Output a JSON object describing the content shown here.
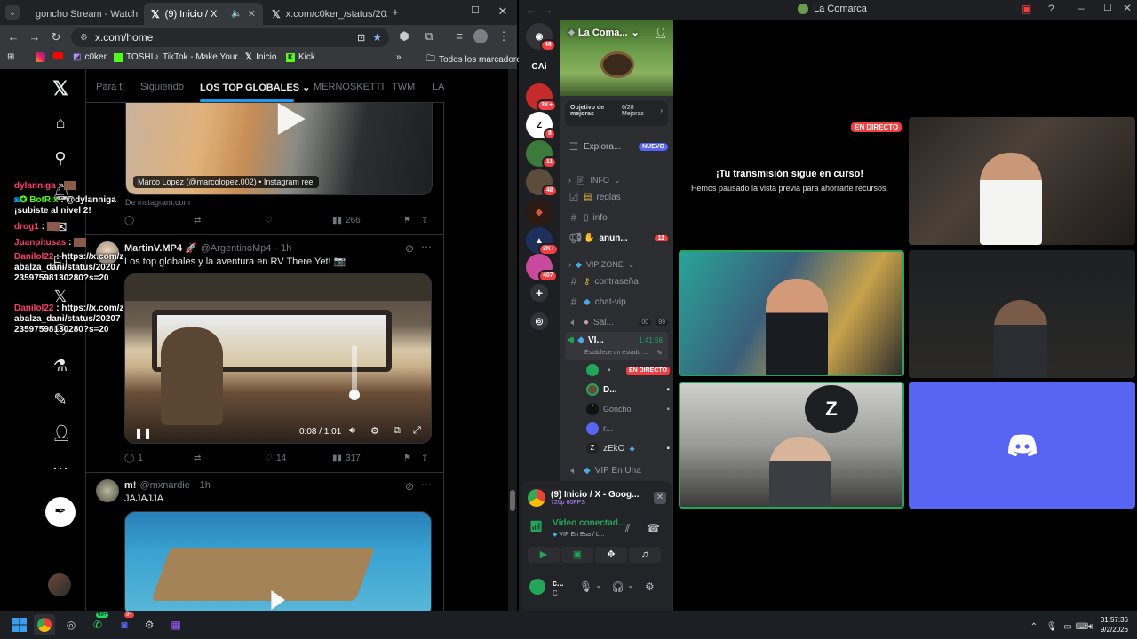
{
  "chrome": {
    "tabs": [
      {
        "title": "goncho Stream - Watch"
      },
      {
        "title": "(9) Inicio / X"
      },
      {
        "title": "x.com/c0ker_/status/202"
      }
    ],
    "url": "x.com/home",
    "bookmarks": [
      "c0ker",
      "TOSHI",
      "TikTok - Make Your...",
      "Inicio",
      "Kick"
    ],
    "all_bookmarks": "Todos los marcadores"
  },
  "x": {
    "tabs": [
      "Para ti",
      "Siguiendo",
      "LOS TOP GLOBALES",
      "MERNOSKETTI",
      "TWM",
      "LA"
    ],
    "post1": {
      "caption": "Marco Lopez (@marcolopez.002) • Instagram reel",
      "source": "De instagram.com",
      "views": "266"
    },
    "post2": {
      "name": "MartinV.MP4 🚀",
      "handle": "@ArgentinoMp4",
      "time": "· 1h",
      "text": "Los top globales y la aventura en RV There Yet! 📷",
      "video_time": "0:08 / 1:01",
      "replies": "1",
      "likes": "14",
      "views": "317"
    },
    "post3": {
      "name": "m!",
      "handle": "@mxnardie",
      "time": "· 1h",
      "text": "JAJAJJA"
    }
  },
  "chat": [
    {
      "user": "dylanniga",
      "text": ":",
      "color": "#ff3d6e"
    },
    {
      "user": "BotRix",
      "text": ": @dylanniga ¡subiste al nivel 2!",
      "color": "#53fc18"
    },
    {
      "user": "drog1",
      "text": ":",
      "color": "#ff3d6e"
    },
    {
      "user": "Juanpitusas",
      "text": ":",
      "color": "#ff3d6e"
    },
    {
      "user": "Danilol22",
      "text": ": https://x.com/zabalza_dani/status/2020723597598130280?s=20",
      "color": "#ff3d6e"
    },
    {
      "user": "Danilol22",
      "text": ": https://x.com/zabalza_dani/status/2020723597598130280?s=20",
      "color": "#ff3d6e"
    }
  ],
  "discord": {
    "window_title": "La Comarca",
    "server_name": "La Coma...",
    "boost_goal": "Objetivo de mejoras",
    "boost_count": "6/28 Mejoras",
    "explore": "Explora...",
    "new_badge": "NUEVO",
    "servers": [
      {
        "badge": "46"
      },
      {
        "label": "CAi"
      },
      {
        "badge": "3K+"
      },
      {
        "badge": "8"
      },
      {
        "badge": "11"
      },
      {
        "badge": "48"
      },
      {},
      {
        "badge": "2K+"
      },
      {
        "badge": "407"
      }
    ],
    "categories": [
      "INFO",
      "VIP ZONE"
    ],
    "channels": [
      "reglas",
      "info",
      "anun...",
      "contraseña",
      "chat-vip",
      "Sal...",
      "VI...",
      "VIP En Una"
    ],
    "announce_badge": "11",
    "sal_counts": [
      "00",
      "99"
    ],
    "vi_timer": "1:41:56",
    "vi_status": "Establece un estado ...",
    "voice_users": [
      "",
      "D...",
      "Goncho",
      "r...",
      "zEkO"
    ],
    "live_badge": "EN DIRECTO",
    "stream_title": "(9) Inicio / X - Goog...",
    "stream_quality": "720p 60FPS",
    "voice_connected": "Vídeo conectad...",
    "voice_channel": "VIP En Esa / L...",
    "user_name": "c...",
    "user_status": "C",
    "stage_live": "EN DIRECTO",
    "stage_msg": "¡Tu transmisión sigue en curso!",
    "stage_sub": "Hemos pausado la vista previa para ahorrarte recursos."
  },
  "taskbar": {
    "time": "01:57:36",
    "date": "9/2/2026",
    "whatsapp_badge": "99+",
    "discord_badge": "9+"
  }
}
